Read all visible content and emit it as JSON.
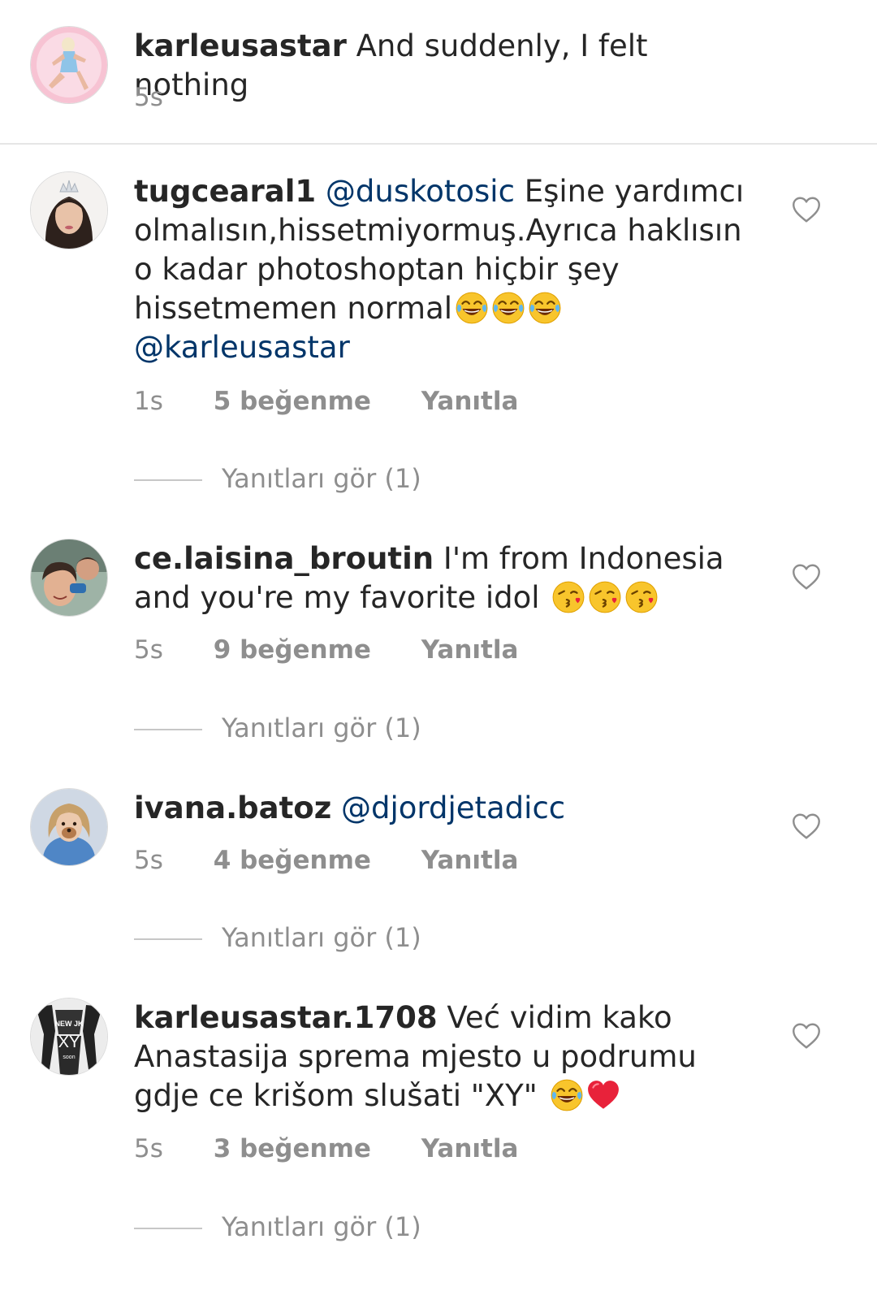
{
  "caption": {
    "username": "karleusastar",
    "text": "And suddenly, I felt nothing",
    "time": "5s"
  },
  "comments": [
    {
      "username": "tugcearal1",
      "mention": "@duskotosic",
      "text": "Eşine yardımcı olmalısın,hissetmiyormuş.Ayrıca haklısın o kadar photoshoptan hiçbir şey hissetmemen normal",
      "emojis": [
        "tears-of-joy",
        "tears-of-joy",
        "tears-of-joy"
      ],
      "trailing_mention": "@karleusastar",
      "time": "1s",
      "likes": "5 beğenme",
      "reply": "Yanıtla",
      "view_replies": "Yanıtları gör (1)"
    },
    {
      "username": "ce.laisina_broutin",
      "text": "I'm from Indonesia and you're my favorite idol",
      "emojis": [
        "kissing-heart",
        "kissing-heart",
        "kissing-heart"
      ],
      "time": "5s",
      "likes": "9 beğenme",
      "reply": "Yanıtla",
      "view_replies": "Yanıtları gör (1)"
    },
    {
      "username": "ivana.batoz",
      "mention": "@djordjetadicc",
      "time": "5s",
      "likes": "4 beğenme",
      "reply": "Yanıtla",
      "view_replies": "Yanıtları gör (1)"
    },
    {
      "username": "karleusastar.1708",
      "text": "Već vidim kako Anastasija sprema mjesto u podrumu gdje ce krišom slušati \"XY\"",
      "emojis": [
        "tears-of-joy",
        "red-heart"
      ],
      "time": "5s",
      "likes": "3 beğenme",
      "reply": "Yanıtla",
      "view_replies": "Yanıtları gör (1)"
    }
  ],
  "avatar_badge": {
    "line1": "NEW JK",
    "line2": "XY",
    "line3": "soon"
  },
  "colors": {
    "text": "#262626",
    "muted": "#8e8e8e",
    "mention": "#003569",
    "divider": "#e6e6e6"
  }
}
